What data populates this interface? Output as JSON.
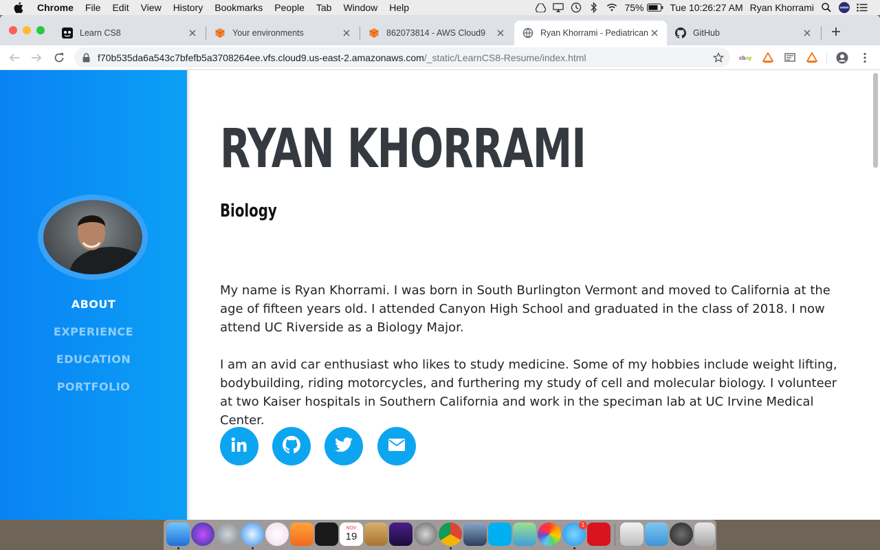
{
  "menubar": {
    "app_name": "Chrome",
    "menus": [
      "File",
      "Edit",
      "View",
      "History",
      "Bookmarks",
      "People",
      "Tab",
      "Window",
      "Help"
    ],
    "battery": "75%",
    "clock": "Tue 10:26:27 AM",
    "user": "Ryan Khorrami"
  },
  "tabs": [
    {
      "title": "Learn CS8",
      "icon": "learncs8-icon",
      "active": false
    },
    {
      "title": "Your environments",
      "icon": "aws-cube-icon",
      "active": false
    },
    {
      "title": "862073814 - AWS Cloud9",
      "icon": "aws-cube-icon",
      "active": false
    },
    {
      "title": "Ryan Khorrami - Pediatrican",
      "icon": "globe-icon",
      "active": true
    },
    {
      "title": "GitHub",
      "icon": "github-icon",
      "active": false
    }
  ],
  "address": {
    "host": "f70b535da6a543c7bfefb5a3708264ee.vfs.cloud9.us-east-2.amazonaws.com",
    "path": "/_static/LearnCS8-Resume/index.html"
  },
  "extensions": [
    "ebay",
    "honey-icon",
    "reader-icon",
    "honey-icon"
  ],
  "sidebar": {
    "nav": [
      {
        "label": "ABOUT",
        "current": true
      },
      {
        "label": "EXPERIENCE",
        "current": false
      },
      {
        "label": "EDUCATION",
        "current": false
      },
      {
        "label": "PORTFOLIO",
        "current": false
      }
    ]
  },
  "about": {
    "name": "RYAN KHORRAMI",
    "subtitle": "Biology",
    "paragraphs": [
      "My name is Ryan Khorrami. I was born in South Burlington Vermont and moved to California at the age of fifteen years old. I attended Canyon High School and graduated in the class of 2018. I now attend UC Riverside as a Biology Major.",
      "I am an avid car enthusiast who likes to study medicine. Some of my hobbies include weight lifting, bodybuilding, riding motorcycles, and furthering my study of cell and molecular biology. I volunteer at two Kaiser hospitals in Southern California and work in the speciman lab at UC Irvine Medical Center."
    ],
    "social": [
      "linkedin-icon",
      "github-icon",
      "twitter-icon",
      "envelope-icon"
    ]
  },
  "colors": {
    "sidebar_start": "#0a82f4",
    "sidebar_end": "#0ba0f5",
    "accent": "#0ea5f0",
    "heading": "#343a40"
  },
  "dock": {
    "calendar_month": "NOV",
    "calendar_day": "19",
    "messages_badge": "1"
  }
}
